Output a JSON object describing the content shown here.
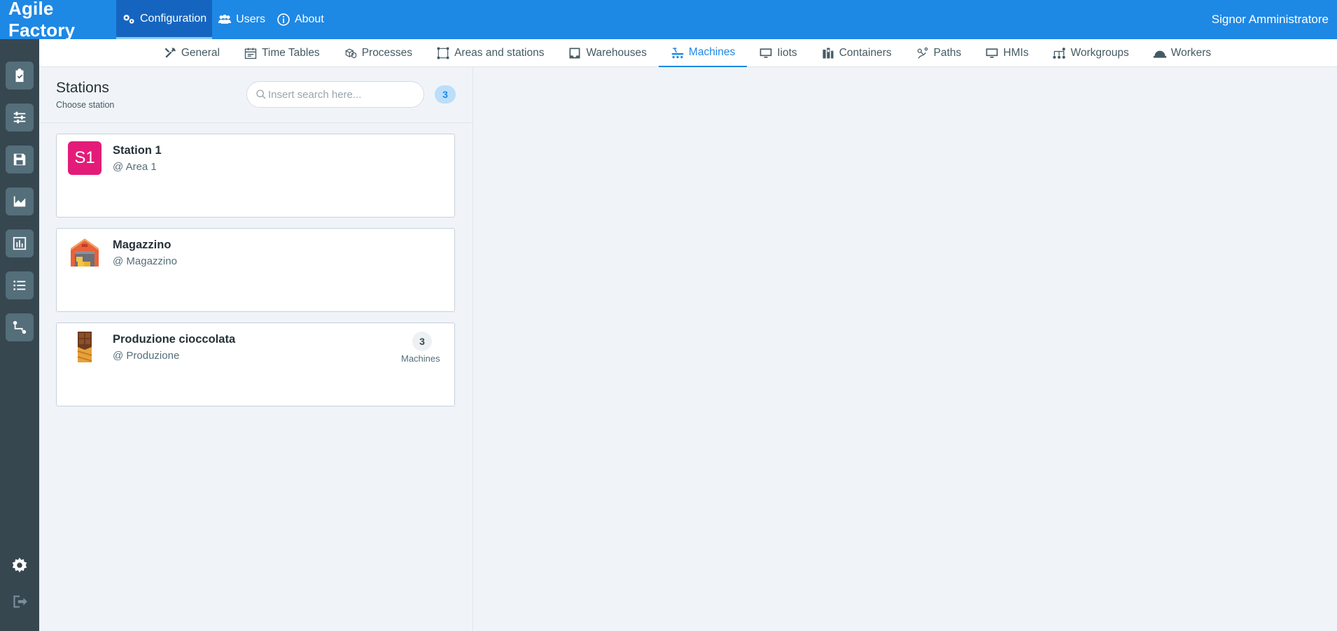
{
  "app": {
    "title": "Agile Factory",
    "user": "Signor Amministratore"
  },
  "topnav": [
    {
      "label": "Configuration",
      "icon": "gears-icon",
      "active": true
    },
    {
      "label": "Users",
      "icon": "users-icon",
      "active": false
    },
    {
      "label": "About",
      "icon": "info-icon",
      "active": false
    }
  ],
  "sidebar": [
    {
      "icon": "clipboard-check-icon"
    },
    {
      "icon": "sliders-icon"
    },
    {
      "icon": "save-icon"
    },
    {
      "icon": "factory-chart-icon"
    },
    {
      "icon": "bar-chart-icon"
    },
    {
      "icon": "list-icon"
    },
    {
      "icon": "flow-icon"
    }
  ],
  "sidebar_bottom": [
    {
      "icon": "gear-icon"
    },
    {
      "icon": "logout-icon"
    }
  ],
  "subnav": [
    {
      "label": "General",
      "icon": "tools-icon"
    },
    {
      "label": "Time Tables",
      "icon": "calendar-icon"
    },
    {
      "label": "Processes",
      "icon": "cubes-icon"
    },
    {
      "label": "Areas and stations",
      "icon": "area-icon"
    },
    {
      "label": "Warehouses",
      "icon": "inbox-icon"
    },
    {
      "label": "Machines",
      "icon": "conveyor-icon",
      "active": true
    },
    {
      "label": "Iiots",
      "icon": "monitor-icon"
    },
    {
      "label": "Containers",
      "icon": "containers-icon"
    },
    {
      "label": "Paths",
      "icon": "path-icon"
    },
    {
      "label": "HMIs",
      "icon": "monitor-icon"
    },
    {
      "label": "Workgroups",
      "icon": "workgroups-icon"
    },
    {
      "label": "Workers",
      "icon": "helmet-icon"
    }
  ],
  "panel": {
    "title": "Stations",
    "subtitle": "Choose station",
    "search_placeholder": "Insert search here...",
    "count": "3"
  },
  "stations": [
    {
      "name": "Station 1",
      "area": "@ Area 1",
      "icon_text": "S1",
      "icon": "station-badge-icon",
      "icon_color": "#e31c79"
    },
    {
      "name": "Magazzino",
      "area": "@ Magazzino",
      "icon": "warehouse-icon"
    },
    {
      "name": "Produzione cioccolata",
      "area": "@ Produzione",
      "icon": "chocolate-icon",
      "machines_count": "3",
      "machines_label": "Machines"
    }
  ],
  "colors": {
    "accent": "#1e88e5",
    "accent_dark": "#1565c0",
    "sidebar": "#37474f",
    "sidebar_button": "#546e7a"
  }
}
